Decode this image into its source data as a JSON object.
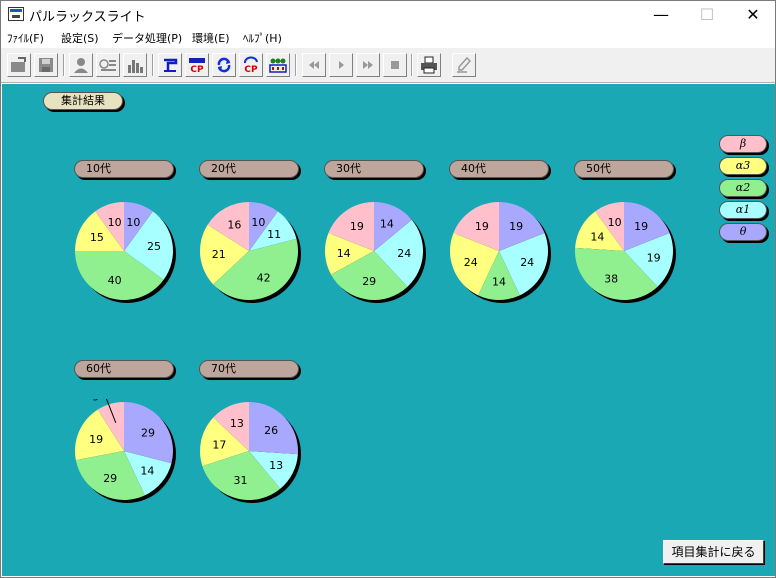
{
  "window": {
    "title": "パルラックスライト",
    "minimize": "—",
    "maximize": "☐",
    "close": "✕"
  },
  "menu": [
    "ﾌｧｲﾙ(F)",
    "設定(S)",
    "データ処理(P)",
    "環境(E)",
    "ﾍﾙﾌﾟ(H)"
  ],
  "toolbar": {
    "buttons": [
      "open-icon",
      "save-icon",
      "person-icon",
      "card-icon",
      "histogram-icon",
      "cup-icon",
      "cp-icon",
      "refresh-icon",
      "refresh-cp-icon",
      "group-icon",
      "first-icon",
      "prev-icon",
      "next-icon",
      "stop-icon",
      "print-icon",
      "edit-icon"
    ]
  },
  "summary_label": "集計結果",
  "legend": [
    {
      "label": "β",
      "color": "#ffc0cb"
    },
    {
      "label": "α3",
      "color": "#ffff80"
    },
    {
      "label": "α2",
      "color": "#90f090"
    },
    {
      "label": "α1",
      "color": "#a8ffff"
    },
    {
      "label": "θ",
      "color": "#a8a8ff"
    }
  ],
  "back_button": "項目集計に戻る",
  "chart_data": [
    {
      "type": "pie",
      "title": "10代",
      "categories": [
        "β",
        "α3",
        "α2",
        "α1",
        "θ"
      ],
      "values": [
        10,
        15,
        40,
        25,
        10
      ]
    },
    {
      "type": "pie",
      "title": "20代",
      "categories": [
        "β",
        "α3",
        "α2",
        "α1",
        "θ"
      ],
      "values": [
        16,
        21,
        42,
        11,
        10
      ]
    },
    {
      "type": "pie",
      "title": "30代",
      "categories": [
        "β",
        "α3",
        "α2",
        "α1",
        "θ"
      ],
      "values": [
        19,
        14,
        29,
        24,
        14
      ]
    },
    {
      "type": "pie",
      "title": "40代",
      "categories": [
        "β",
        "α3",
        "α2",
        "α1",
        "θ"
      ],
      "values": [
        19,
        24,
        14,
        24,
        19
      ]
    },
    {
      "type": "pie",
      "title": "50代",
      "categories": [
        "β",
        "α3",
        "α2",
        "α1",
        "θ"
      ],
      "values": [
        10,
        14,
        38,
        19,
        19
      ]
    },
    {
      "type": "pie",
      "title": "60代",
      "categories": [
        "β",
        "α3",
        "α2",
        "α1",
        "θ"
      ],
      "values": [
        9,
        19,
        29,
        14,
        29
      ]
    },
    {
      "type": "pie",
      "title": "70代",
      "categories": [
        "β",
        "α3",
        "α2",
        "α1",
        "θ"
      ],
      "values": [
        13,
        17,
        31,
        13,
        26
      ]
    }
  ]
}
